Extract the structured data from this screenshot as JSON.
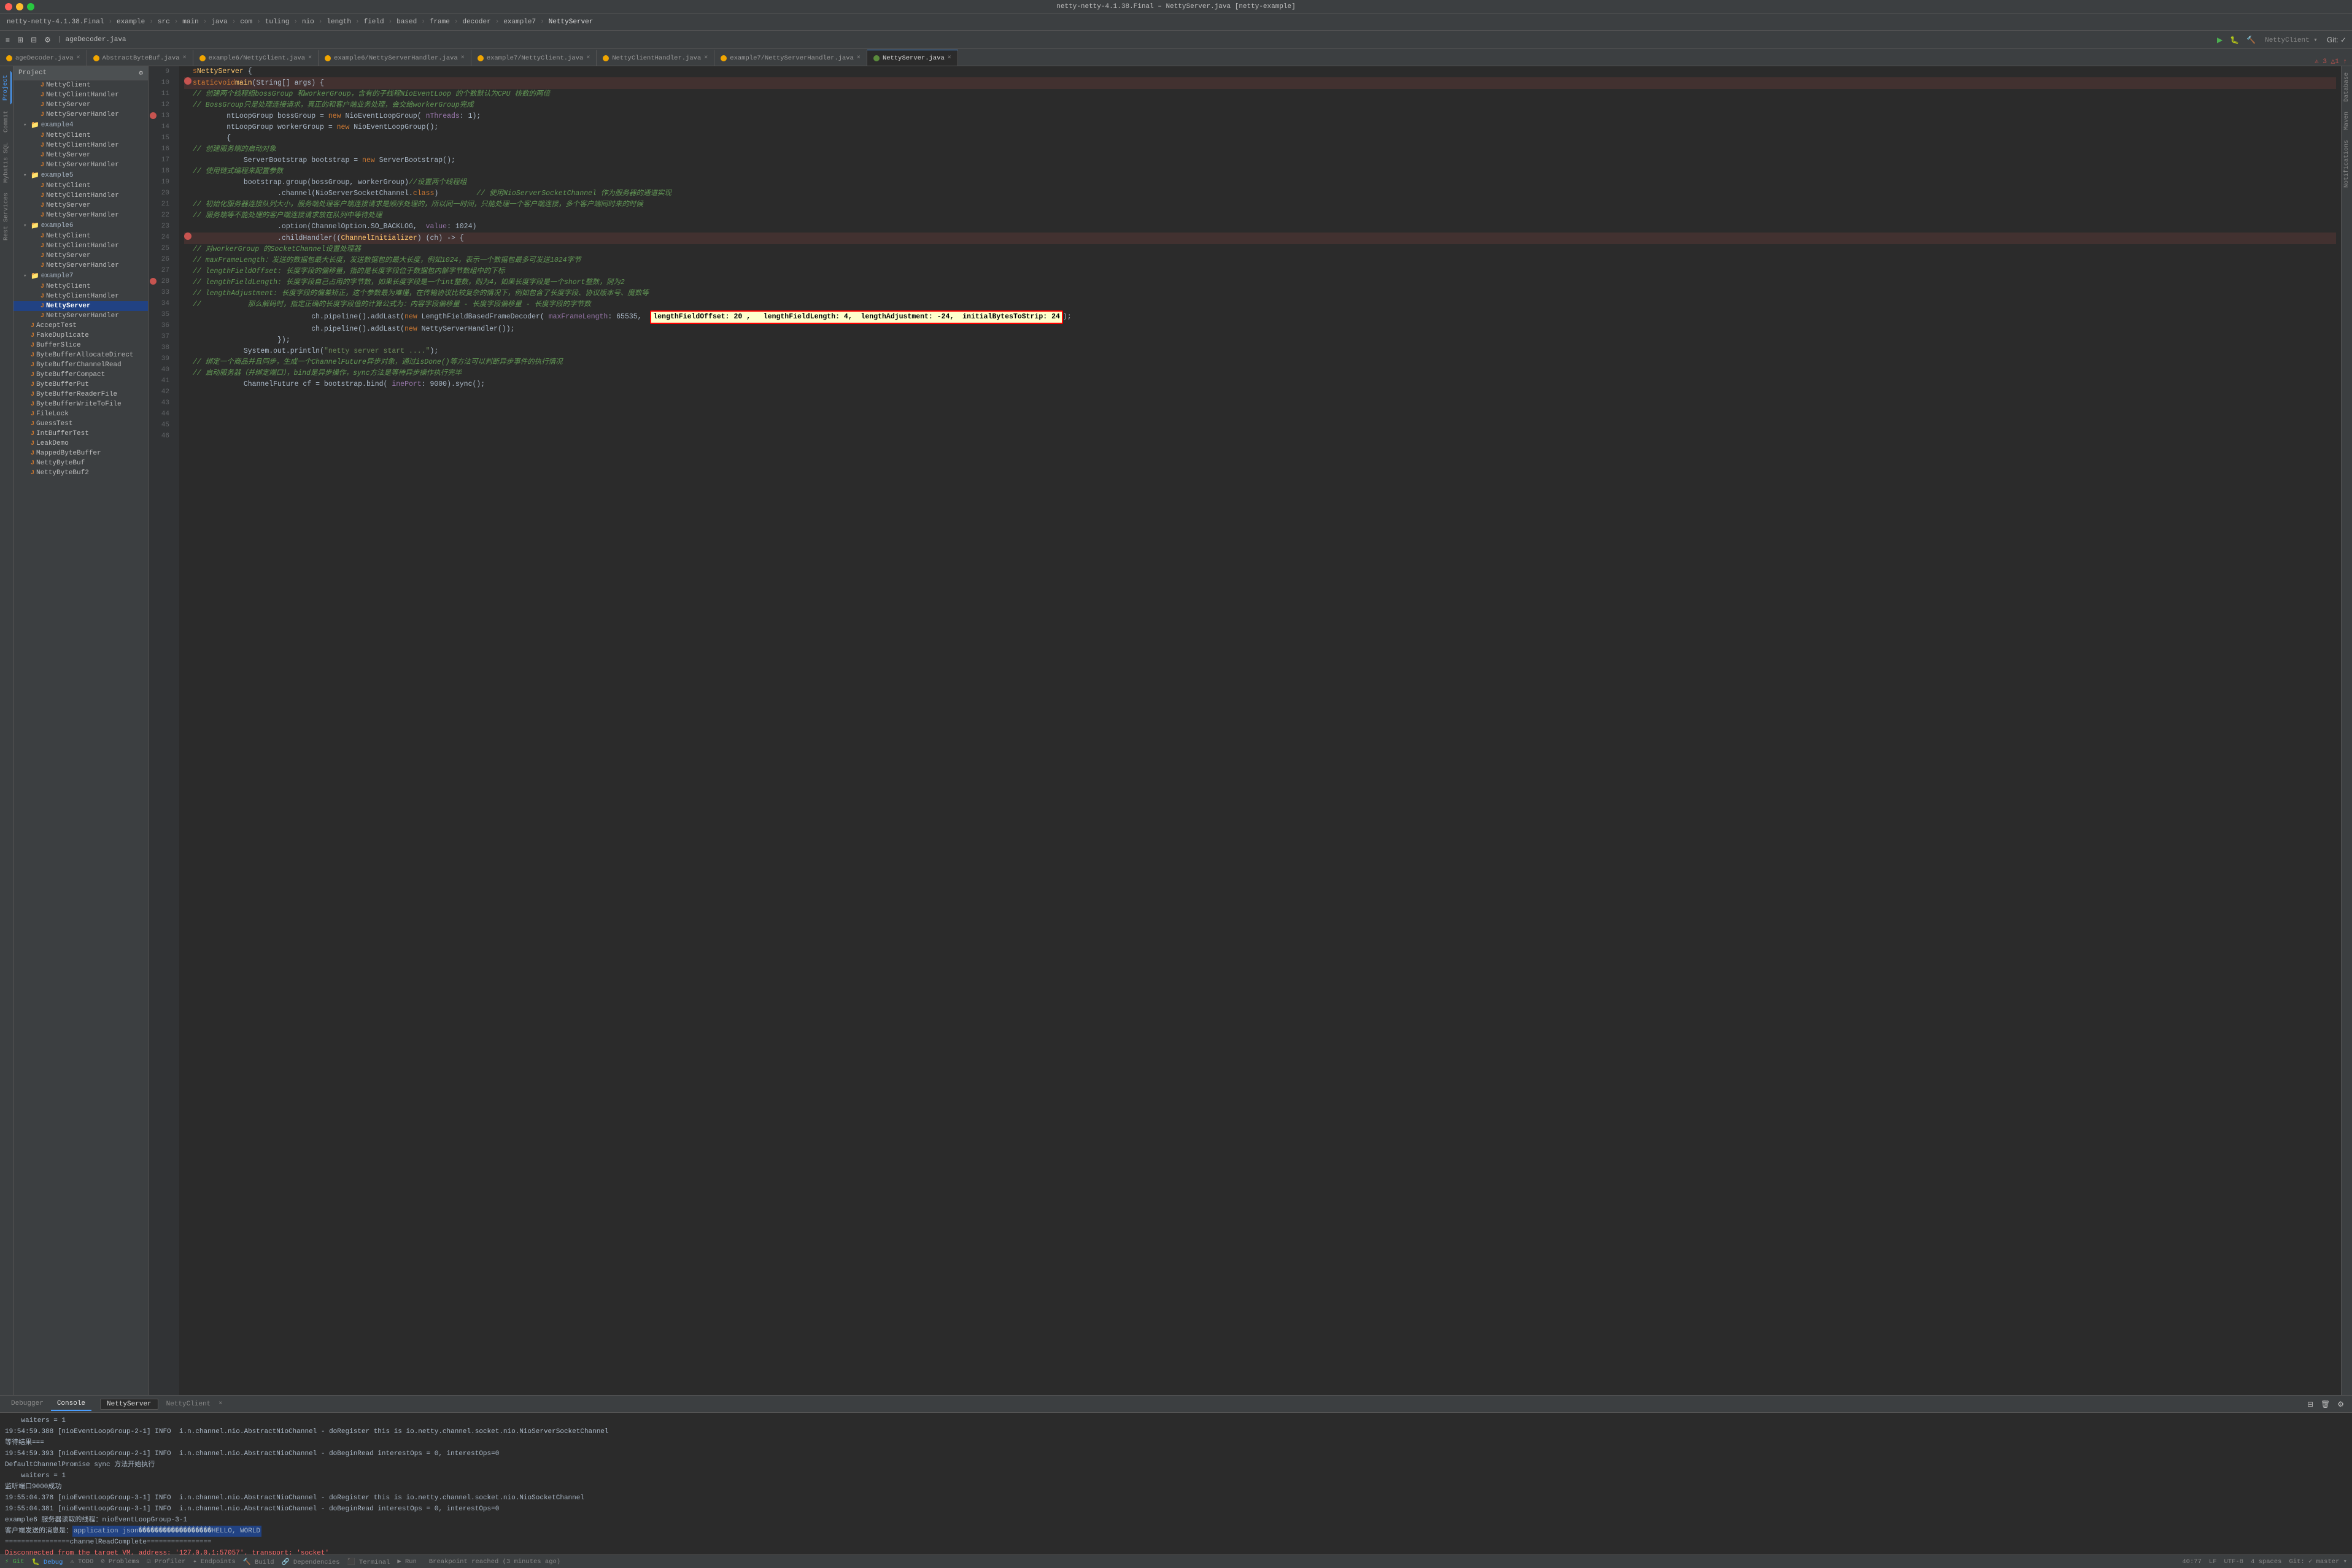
{
  "titleBar": {
    "title": "netty-netty-4.1.38.Final – NettyServer.java [netty-example]"
  },
  "windowControls": {
    "close": "×",
    "minimize": "−",
    "maximize": "+"
  },
  "navBreadcrumb": {
    "items": [
      "netty-netty-4.1.38.Final",
      "example",
      "src",
      "main",
      "java",
      "com",
      "tuling",
      "nio",
      "length",
      "field",
      "based",
      "frame",
      "decoder",
      "example7",
      "NettyServer"
    ]
  },
  "toolbar": {
    "buttons": [
      "≡",
      "⊞",
      "⊟",
      "⚙",
      "ageDecoder.java"
    ]
  },
  "tabs": [
    {
      "label": "ageDecoder.java",
      "type": "orange",
      "active": false
    },
    {
      "label": "AbstractByteBuf.java",
      "type": "orange",
      "active": false
    },
    {
      "label": "example6/NettyClient.java",
      "type": "orange",
      "active": false
    },
    {
      "label": "example6/NettyServerHandler.java",
      "type": "orange",
      "active": false
    },
    {
      "label": "example7/NettyClient.java",
      "type": "orange",
      "active": false
    },
    {
      "label": "NettyClientHandler.java",
      "type": "orange",
      "active": false
    },
    {
      "label": "example7/NettyServerHandler.java",
      "type": "orange",
      "active": false
    },
    {
      "label": "NettyServer.java",
      "type": "green",
      "active": true
    }
  ],
  "sidebar": {
    "header": "Project",
    "items": [
      {
        "label": "NettyClient",
        "indent": 2,
        "type": "java",
        "icon": "J"
      },
      {
        "label": "NettyClientHandler",
        "indent": 2,
        "type": "java",
        "icon": "J"
      },
      {
        "label": "NettyServer",
        "indent": 2,
        "type": "java",
        "icon": "J"
      },
      {
        "label": "NettyServerHandler",
        "indent": 2,
        "type": "java",
        "icon": "J"
      },
      {
        "label": "example4",
        "indent": 1,
        "type": "dir",
        "icon": "▾"
      },
      {
        "label": "NettyClient",
        "indent": 2,
        "type": "java",
        "icon": "J"
      },
      {
        "label": "NettyClientHandler",
        "indent": 2,
        "type": "java",
        "icon": "J"
      },
      {
        "label": "NettyServer",
        "indent": 2,
        "type": "java",
        "icon": "J"
      },
      {
        "label": "NettyServerHandler",
        "indent": 2,
        "type": "java",
        "icon": "J"
      },
      {
        "label": "example5",
        "indent": 1,
        "type": "dir",
        "icon": "▾"
      },
      {
        "label": "NettyClient",
        "indent": 2,
        "type": "java",
        "icon": "J"
      },
      {
        "label": "NettyClientHandler",
        "indent": 2,
        "type": "java",
        "icon": "J"
      },
      {
        "label": "NettyServer",
        "indent": 2,
        "type": "java",
        "icon": "J"
      },
      {
        "label": "NettyServerHandler",
        "indent": 2,
        "type": "java",
        "icon": "J"
      },
      {
        "label": "example6",
        "indent": 1,
        "type": "dir",
        "icon": "▾"
      },
      {
        "label": "NettyClient",
        "indent": 2,
        "type": "java",
        "icon": "J"
      },
      {
        "label": "NettyClientHandler",
        "indent": 2,
        "type": "java",
        "icon": "J"
      },
      {
        "label": "NettyServer",
        "indent": 2,
        "type": "java",
        "icon": "J"
      },
      {
        "label": "NettyServerHandler",
        "indent": 2,
        "type": "java",
        "icon": "J"
      },
      {
        "label": "example7",
        "indent": 1,
        "type": "dir",
        "icon": "▾"
      },
      {
        "label": "NettyClient",
        "indent": 2,
        "type": "java",
        "icon": "J"
      },
      {
        "label": "NettyClientHandler",
        "indent": 2,
        "type": "java",
        "icon": "J"
      },
      {
        "label": "NettyServer",
        "indent": 2,
        "type": "java",
        "icon": "J",
        "active": true
      },
      {
        "label": "NettyServerHandler",
        "indent": 2,
        "type": "java",
        "icon": "J"
      },
      {
        "label": "AcceptTest",
        "indent": 1,
        "type": "java",
        "icon": "J"
      },
      {
        "label": "FakeDuplicate",
        "indent": 1,
        "type": "java",
        "icon": "J"
      },
      {
        "label": "BufferSlice",
        "indent": 1,
        "type": "java",
        "icon": "J"
      },
      {
        "label": "ByteBufferAllocateDirect",
        "indent": 1,
        "type": "java",
        "icon": "J"
      },
      {
        "label": "ByteBufferChannelRead",
        "indent": 1,
        "type": "java",
        "icon": "J"
      },
      {
        "label": "ByteBufferCompact",
        "indent": 1,
        "type": "java",
        "icon": "J"
      },
      {
        "label": "ByteBufferPut",
        "indent": 1,
        "type": "java",
        "icon": "J"
      },
      {
        "label": "ByteBufferReaderFile",
        "indent": 1,
        "type": "java",
        "icon": "J"
      },
      {
        "label": "ByteBufferWriteToFile",
        "indent": 1,
        "type": "java",
        "icon": "J"
      },
      {
        "label": "FileLock",
        "indent": 1,
        "type": "java",
        "icon": "J"
      },
      {
        "label": "GuessTest",
        "indent": 1,
        "type": "java",
        "icon": "J"
      },
      {
        "label": "IntBufferTest",
        "indent": 1,
        "type": "java",
        "icon": "J"
      },
      {
        "label": "LeakDemo",
        "indent": 1,
        "type": "java",
        "icon": "J"
      },
      {
        "label": "MappedByteBuffer",
        "indent": 1,
        "type": "java",
        "icon": "J"
      },
      {
        "label": "NettyByteBuf",
        "indent": 1,
        "type": "java",
        "icon": "J"
      },
      {
        "label": "NettyByteBuf2",
        "indent": 1,
        "type": "java",
        "icon": "J"
      }
    ]
  },
  "editor": {
    "filename": "NettyServer.java",
    "lines": [
      {
        "num": 9,
        "code": "",
        "indent": 0
      },
      {
        "num": 10,
        "code": ""
      },
      {
        "num": 11,
        "code": ""
      },
      {
        "num": 12,
        "code": ""
      },
      {
        "num": 13,
        "code": "    <kw>static</kw> <kw>void</kw> <fn>main</fn>(String[] args) {",
        "hasBreakpoint": true,
        "isCurrent": false
      },
      {
        "num": 14,
        "code": "        // 创建两个线程组bossGroup 和workerGroup，含有的子线程NioEventLoop 的个数默认为CPU 核数的两倍",
        "isCmt": true
      },
      {
        "num": 15,
        "code": "        // BossGroup只是处理连接请求，真正的和客户端业务处理，会交给workerGroup完成",
        "isCmt": true
      },
      {
        "num": 16,
        "code": "        ntLoopGroup bossGroup = <kw>new</kw> NioEventLoopGroup( nThreads: 1);"
      },
      {
        "num": 17,
        "code": "        ntLoopGroup workerGroup = <kw>new</kw> NioEventLoopGroup();"
      },
      {
        "num": 18,
        "code": ""
      },
      {
        "num": 19,
        "code": "        {"
      },
      {
        "num": 20,
        "code": "            // 创建服务端的启动对象",
        "isCmt": true
      },
      {
        "num": 21,
        "code": "            ServerBootstrap bootstrap = <kw>new</kw> ServerBootstrap();"
      },
      {
        "num": 22,
        "code": "            // 使用链式编程来配置参数",
        "isCmt": true
      },
      {
        "num": 23,
        "code": "            bootstrap.group(bossGroup, workerGroup)//设置两个线程组"
      },
      {
        "num": 24,
        "code": "                    .channel(NioServerSocketChannel.<kw>class</kw>)         // 使用NioServerSocketChannel 作为服务器的通道实现"
      },
      {
        "num": 25,
        "code": "                    // 初始化服务器连接队列大小，服务端处理客户端连接请求是顺序处理的，所以同一时间，只能处理一个客户端连接，多个客户端同时来的时候"
      },
      {
        "num": 26,
        "code": "                    // 服务端等不能处理的客户端连接请求放在队列中等待处理"
      },
      {
        "num": 27,
        "code": "                    .option(ChannelOption.SO_BACKLOG,  value: 1024)"
      },
      {
        "num": 28,
        "code": "                    .childHandler((ChannelInitializer) (ch) -> {",
        "hasBreakpoint": true
      },
      {
        "num": 33,
        "code": "                            // 对workerGroup 的SocketChannel设置处理器"
      },
      {
        "num": 34,
        "code": "                            // maxFrameLength：发送的数据包最大长度，发送数据包的最大长度，例如1024，表示一个数据包最多可发送1024字节"
      },
      {
        "num": 35,
        "code": "                            // lengthFieldOffset: 长度字段的偏移量，指的是长度字段位于数据包内部字节数组中的下标"
      },
      {
        "num": 36,
        "code": "                            // lengthFieldLength: 长度字段自己占用的字节数，如果长度字段是一个int整数，则为4，如果长度字段是一个short整数，则为2"
      },
      {
        "num": 37,
        "code": "                            // lengthAdjustment: 长度字段的偏差矫正，这个参数最为难懂，在传输协议比较复杂的情况下，例如包含了长度字段、协议版本号、魔数等"
      },
      {
        "num": 38,
        "code": "                            //           那么解码时，指定正确的长度字段值的计算公式为：内容字段偏移量 - 长度字段偏移量 - 长度字段的字节数"
      },
      {
        "num": 39,
        "code": "                            //",
        "hasHighlight": true
      },
      {
        "num": 40,
        "code": "                            ch.pipeline().addLast(<kw>new</kw> NettyServerHandler());"
      },
      {
        "num": 41,
        "code": "                    });"
      },
      {
        "num": 42,
        "code": ""
      },
      {
        "num": 43,
        "code": "            System.out.println(\"netty server start ....\");"
      },
      {
        "num": 44,
        "code": "            // 绑定一个商品并且同步，生成一个ChannelFuture异步对象，通过isDone()等方法可以判断异步事件的执行情况",
        "isCmt": true
      },
      {
        "num": 45,
        "code": "            // 启动服务器（并绑定端口），bind是异步操作，sync方法是等待异步操作执行完毕",
        "isCmt": true
      },
      {
        "num": 46,
        "code": "            ChannelFuture cf = bootstrap.bind( inePort: 9000).sync();"
      }
    ]
  },
  "line39": {
    "before": "                            ch.pipeline().addLast(new LengthFieldBasedFrameDecoder( maxFrameLength: 65535,",
    "highlight": "lengthFieldOffset: 20 ,   lengthFieldLength: 4,  lengthAdjustment: -24,  initialBytesToStrip: 24",
    "after": ");"
  },
  "debugPanel": {
    "tabs": [
      "Debugger",
      "Console"
    ],
    "activeTab": "Console",
    "sessionTabs": [
      "NettyServer",
      "NettyClient"
    ],
    "activeSession": "NettyServer",
    "lines": [
      {
        "text": "    waiters = 1"
      },
      {
        "text": "19:54:59.388 [nioEventLoopGroup-2-1] INFO  i.n.channel.nio.AbstractNioChannel - doRegister this is io.netty.channel.socket.nio.NioServerSocketChannel"
      },
      {
        "text": "等待结果==="
      },
      {
        "text": "19:54:59.393 [nioEventLoopGroup-2-1] INFO  i.n.channel.nio.AbstractNioChannel - doBeginRead interestOps = 0, interestOps=0"
      },
      {
        "text": "DefaultChannelPromise sync 方法开始执行"
      },
      {
        "text": "    waiters = 1"
      },
      {
        "text": "监听端口9000成功"
      },
      {
        "text": "19:55:04.378 [nioEventLoopGroup-3-1] INFO  i.n.channel.nio.AbstractNioChannel - doRegister this is io.netty.channel.socket.nio.NioSocketChannel"
      },
      {
        "text": "19:55:04.381 [nioEventLoopGroup-3-1] INFO  i.n.channel.nio.AbstractNioChannel - doBeginRead interestOps = 0, interestOps=0"
      },
      {
        "text": "example6 服务器读取的线程：nioEventLoopGroup-3-1"
      },
      {
        "text": "客户端发送的消息是：application json\u0000\u0000\u0000\u0000\u0000\u0000\u0000\u0000\u0000\u0000\u0000\u0000\u0000\u0000\u0000\u0000\u0000\u0000HELLO, WORLD",
        "isSelected": true
      },
      {
        "text": "================channelReadComplete================"
      },
      {
        "text": ""
      },
      {
        "text": "Disconnected from the target VM, address: '127.0.0.1:57057', transport: 'socket'"
      }
    ]
  },
  "statusBar": {
    "left": [
      "⚡ Git",
      "🐛 Debug",
      "⚠ TODO",
      "⊘ Problems",
      "☑ Profiler",
      "✦ Endpoints",
      "🔨 Build",
      "🔗 Dependencies",
      "⬛ Terminal",
      "▶ Run"
    ],
    "breakpointMsg": "Breakpoint reached (3 minutes ago)",
    "right": [
      "40:77",
      "LF",
      "UTF-8",
      "4 spaces",
      "Git: ✓ master ▾"
    ]
  },
  "icons": {
    "folder": "📁",
    "java": "☕",
    "arrow": "▶",
    "close": "×",
    "settings": "⚙",
    "debug": "🐛"
  }
}
